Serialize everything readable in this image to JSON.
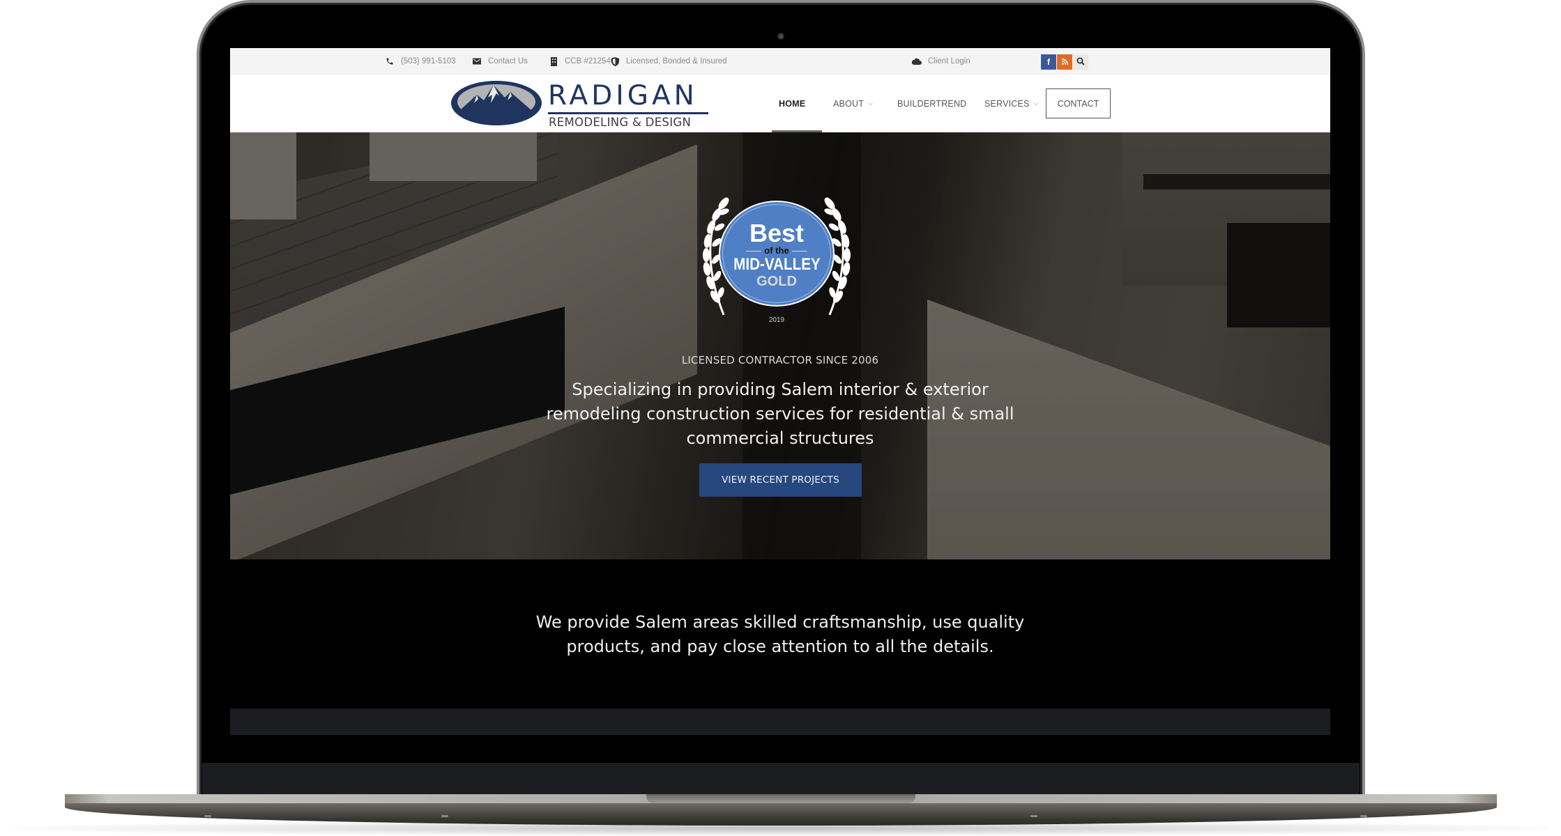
{
  "topbar": {
    "phone": "(503) 991-5103",
    "contact": "Contact Us",
    "ccb": "CCB #212540",
    "licensed": "Licensed, Bonded & Insured",
    "client_login": "Client Login",
    "social": {
      "facebook": "f",
      "rss": "rss",
      "search": "search"
    },
    "colors": {
      "facebook": "#3b5998",
      "rss": "#e06b26"
    }
  },
  "logo": {
    "name": "RADIGAN",
    "tagline": "REMODELING & DESIGN"
  },
  "nav": {
    "items": [
      {
        "label": "HOME",
        "active": true,
        "dropdown": false
      },
      {
        "label": "ABOUT",
        "active": false,
        "dropdown": true
      },
      {
        "label": "BUILDERTREND",
        "active": false,
        "dropdown": false
      },
      {
        "label": "SERVICES",
        "active": false,
        "dropdown": true
      }
    ],
    "contact_label": "CONTACT",
    "chevron": "⌄"
  },
  "hero": {
    "badge": {
      "line1": "Best",
      "line2": "of the",
      "line3": "MID-VALLEY",
      "line4": "GOLD",
      "year": "2019"
    },
    "kicker": "LICENSED CONTRACTOR SINCE 2006",
    "headline": "Specializing in providing Salem interior & exterior remodeling construction services for residential & small commercial structures",
    "cta_label": "VIEW RECENT PROJECTS",
    "cta_color": "#26487f"
  },
  "intro": {
    "text": "We provide Salem areas skilled craftsmanship, use quality products, and pay close attention to all the details."
  }
}
